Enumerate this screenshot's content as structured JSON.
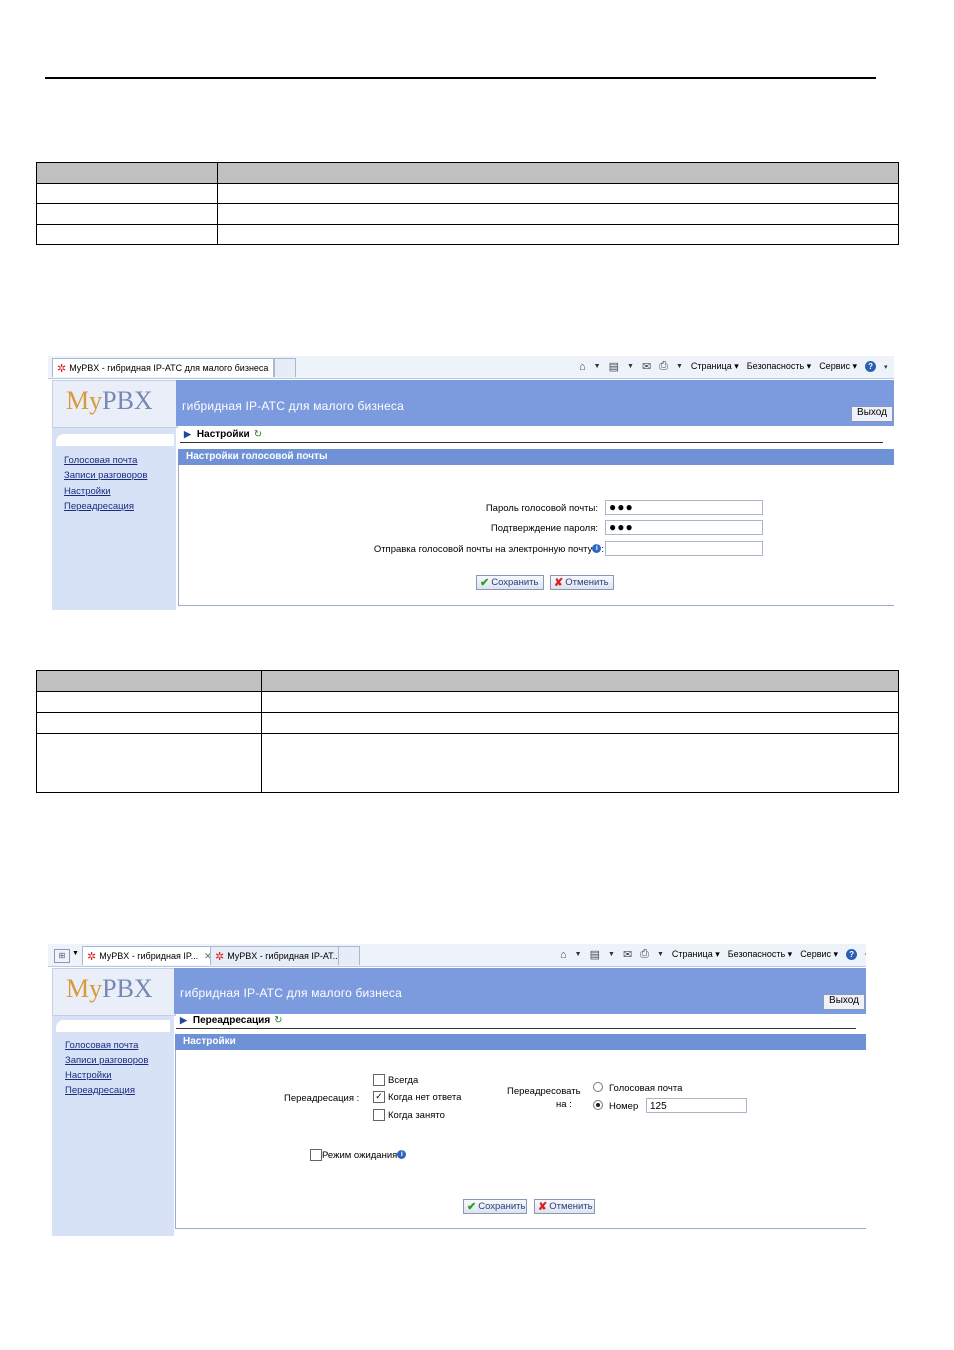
{
  "screen1": {
    "tab_title": "MyPBX - гибридная IP-АТС для малого бизнеса",
    "toolbar": {
      "page": "Страница",
      "security": "Безопасность",
      "service": "Сервис",
      "help": "?"
    },
    "logo": {
      "my": "My",
      "pbx": "PBX"
    },
    "banner_title": "гибридная IP-АТС для малого бизнеса",
    "exit_button": "Выход",
    "nav": [
      "Голосовая почта",
      "Записи разговоров",
      "Настройки",
      "Переадресация"
    ],
    "breadcrumb": "Настройки",
    "section_title": "Настройки голосовой почты",
    "fields": {
      "password_label": "Пароль голосовой почты:",
      "password_value": "●●●",
      "confirm_label": "Подтверждение пароля:",
      "confirm_value": "●●●",
      "email_label": "Отправка голосовой почты на электронную почту",
      "email_suffix": ":",
      "email_value": ""
    },
    "save_button": "Сохранить",
    "cancel_button": "Отменить"
  },
  "screen2": {
    "tab1_title": "MyPBX - гибридная IP...",
    "tab2_title": "MyPBX - гибридная IP-АТ...",
    "toolbar": {
      "page": "Страница",
      "security": "Безопасность",
      "service": "Сервис",
      "help": "?"
    },
    "logo": {
      "my": "My",
      "pbx": "PBX"
    },
    "banner_title": "гибридная IP-АТС для малого бизнеса",
    "exit_button": "Выход",
    "nav": [
      "Голосовая почта",
      "Записи разговоров",
      "Настройки",
      "Переадресация"
    ],
    "breadcrumb": "Переадресация",
    "section_title": "Настройки",
    "forward_label": "Переадресация :",
    "options": [
      {
        "label": "Всегда",
        "checked": false
      },
      {
        "label": "Когда нет ответа",
        "checked": true
      },
      {
        "label": "Когда занято",
        "checked": false
      }
    ],
    "redirect_to_label_line1": "Переадресовать",
    "redirect_to_label_line2": "на :",
    "redirect_options": {
      "voicemail": "Голосовая почта",
      "number": "Номер",
      "selected": "number"
    },
    "number_value": "125",
    "standby_label": "Режим ожидания",
    "save_button": "Сохранить",
    "cancel_button": "Отменить"
  }
}
